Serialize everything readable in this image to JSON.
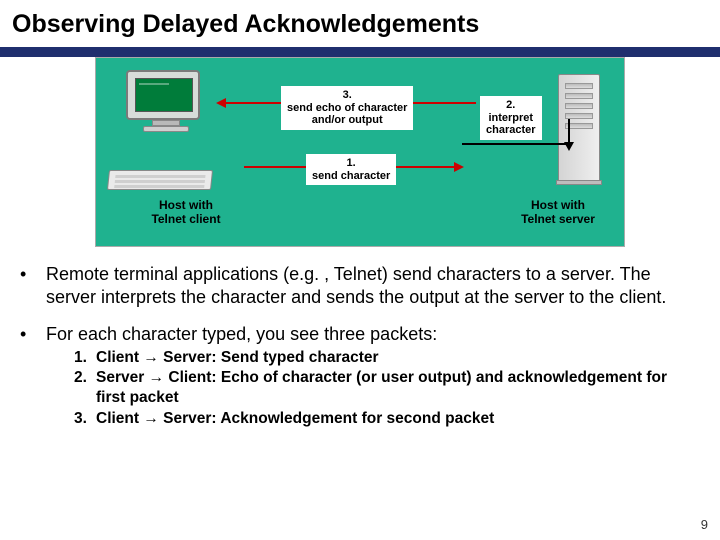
{
  "title": "Observing Delayed Acknowledgements",
  "diagram": {
    "caption_client_l1": "Host with",
    "caption_client_l2": "Telnet client",
    "caption_server_l1": "Host with",
    "caption_server_l2": "Telnet server",
    "step1_num": "1.",
    "step1_text": "send character",
    "step2_num": "2.",
    "step2_l1": "interpret",
    "step2_l2": "character",
    "step3_num": "3.",
    "step3_l1": "send echo of character",
    "step3_l2": "and/or  output"
  },
  "bullets": {
    "b1": "Remote terminal applications (e.g. , Telnet) send characters to a server. The server interprets the character and sends the output at the server to the client.",
    "b2": "For each character typed, you see three packets:"
  },
  "numbered": {
    "n1_num": "1.",
    "n1_text": "Client → Server: Send typed character",
    "n2_num": "2.",
    "n2_text": "Server → Client: Echo of character (or user output) and acknowledgement for first packet",
    "n3_num": "3.",
    "n3_text": "Client → Server: Acknowledgement for second packet"
  },
  "page_number": "9"
}
